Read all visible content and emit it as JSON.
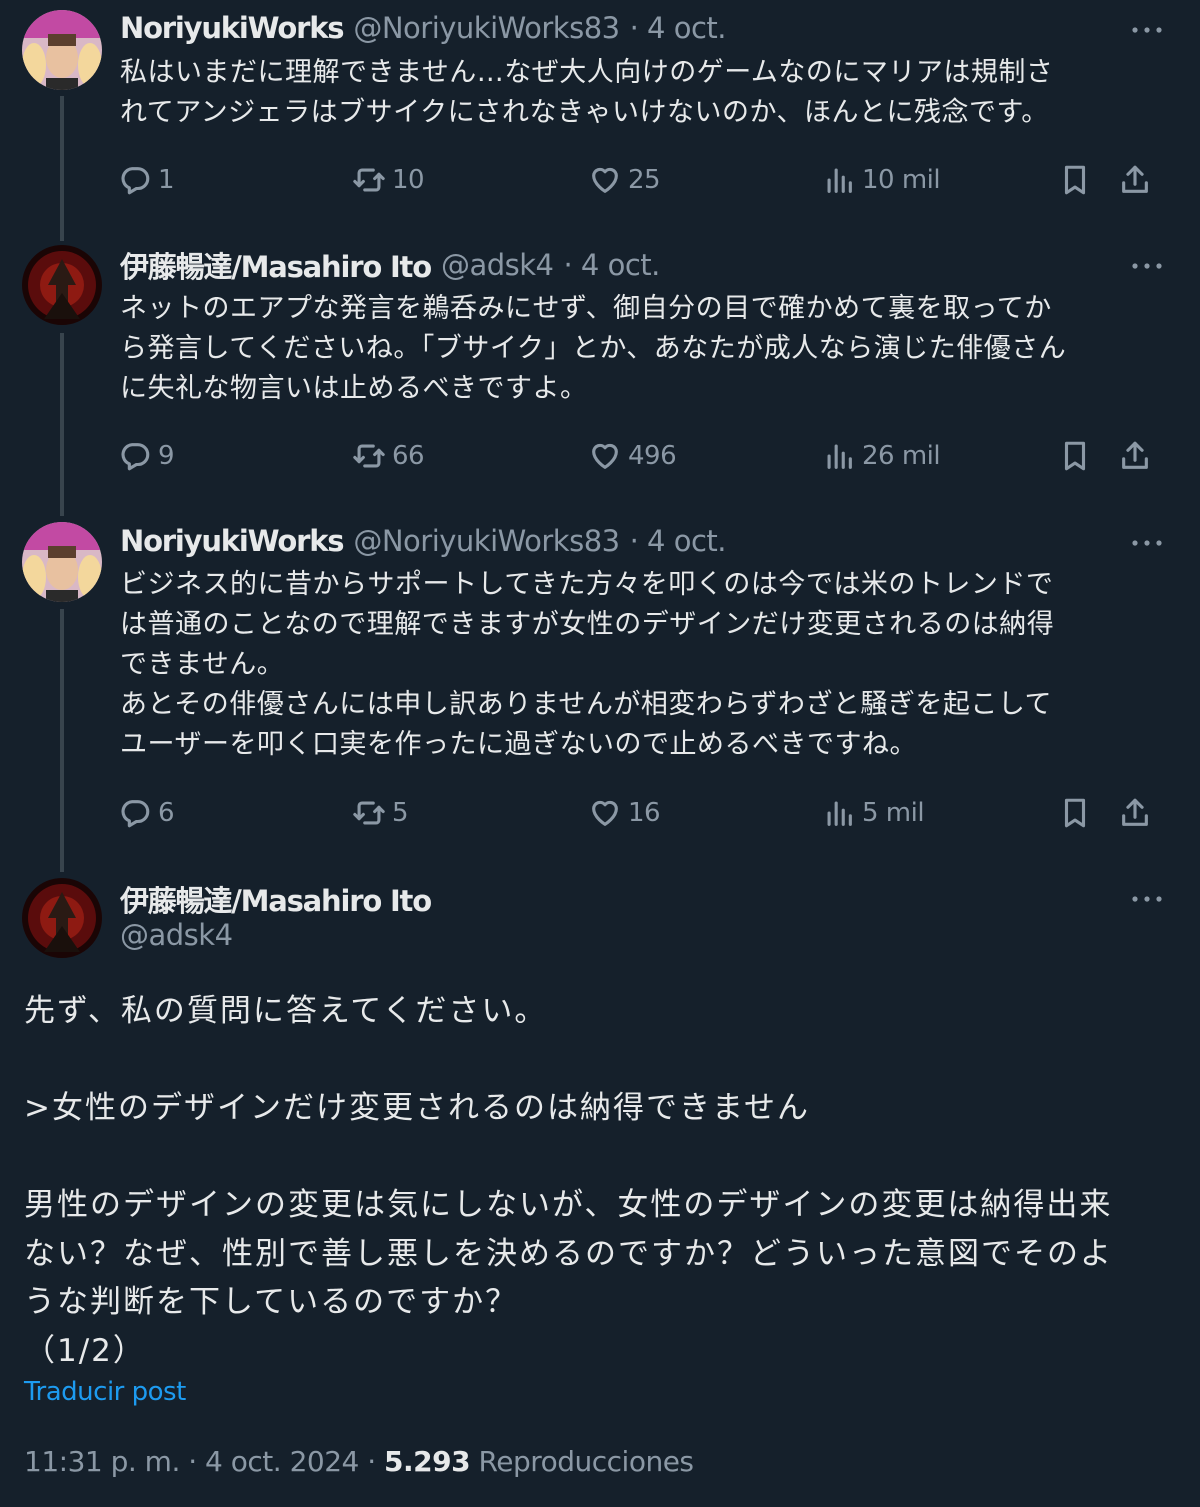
{
  "tweets": [
    {
      "author": "NoriyukiWorks",
      "handle": "@NoriyukiWorks83",
      "date": "· 4 oct.",
      "text": "私はいまだに理解できません…なぜ大人向けのゲームなのにマリアは規制さ\nれてアンジェラはブサイクにされなきゃいけないのか、ほんとに残念です。",
      "replies": "1",
      "reposts": "10",
      "likes": "25",
      "views": "10 mil"
    },
    {
      "author": "伊藤暢達/Masahiro Ito",
      "handle": "@adsk4",
      "date": "· 4 oct.",
      "text": "ネットのエアプな発言を鵜呑みにせず、御自分の目で確かめて裏を取ってか\nら発言してくださいね。「ブサイク」とか、あなたが成人なら演じた俳優さん\nに失礼な物言いは止めるべきですよ。",
      "replies": "9",
      "reposts": "66",
      "likes": "496",
      "views": "26 mil"
    },
    {
      "author": "NoriyukiWorks",
      "handle": "@NoriyukiWorks83",
      "date": "· 4 oct.",
      "text": "ビジネス的に昔からサポートしてきた方々を叩くのは今では米のトレンドで\nは普通のことなので理解できますが女性のデザインだけ変更されるのは納得\nできません。\nあとその俳優さんには申し訳ありませんが相変わらずわざと騒ぎを起こして\nユーザーを叩く口実を作ったに過ぎないので止めるべきですね。",
      "replies": "6",
      "reposts": "5",
      "likes": "16",
      "views": "5 mil"
    }
  ],
  "main_tweet": {
    "author": "伊藤暢達/Masahiro Ito",
    "handle": "@adsk4",
    "text": "先ず、私の質問に答えてください。\n\n>女性のデザインだけ変更されるのは納得できません\n\n男性のデザインの変更は気にしないが、女性のデザインの変更は納得出来\nない？なぜ、性別で善し悪しを決めるのですか？どういった意図でそのよ\nうな判断を下しているのですか？\n（1/2）",
    "translate_label": "Traducir post",
    "timestamp": "11:31 p. m. · 4 oct. 2024 · ",
    "views_count": "5.293",
    "views_label": "Reproducciones"
  },
  "colors": {
    "background": "#15202b",
    "text": "#e7e9ea",
    "muted": "#8b98a5",
    "link": "#1d9bf0",
    "thread_line": "#38444d"
  },
  "icons": [
    "reply-icon",
    "repost-icon",
    "like-icon",
    "views-icon",
    "bookmark-icon",
    "share-icon",
    "more-icon"
  ]
}
